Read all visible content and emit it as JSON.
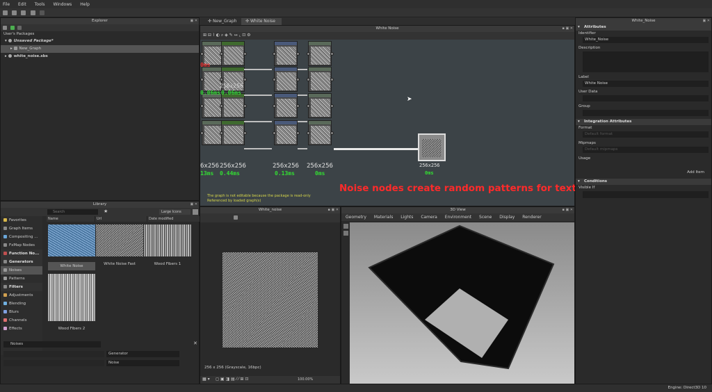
{
  "menu": [
    "File",
    "Edit",
    "Tools",
    "Windows",
    "Help"
  ],
  "explorer": {
    "title": "Explorer",
    "section": "User's Packages",
    "items": [
      {
        "label": "Unsaved Package*",
        "indent": 1
      },
      {
        "label": "New_Graph",
        "indent": 2
      },
      {
        "label": "white_noise.sbs",
        "indent": 1
      }
    ]
  },
  "tabs": [
    "New_Graph",
    "White Noise"
  ],
  "graph": {
    "title": "White Noise",
    "sizes": [
      "6x256",
      "256x256",
      "256x256",
      "256x256",
      "256x256"
    ],
    "times": [
      "13ms",
      "0.44ms",
      "0.13ms",
      "0ms",
      "0ms"
    ],
    "partial_labels": {
      "red": "0ms",
      "green1": "256x256",
      "green2": "0.06ms",
      "green3": "0.06ms"
    },
    "info_line1": "The graph is not editable because the package is read-only",
    "info_line2": "Referenced by loaded graph(s)",
    "caption": "Noise nodes create random patterns for textures"
  },
  "library": {
    "title": "Library",
    "search_placeholder": "Search",
    "view_mode": "Large Icons",
    "columns": [
      "Name",
      "Url",
      "Date modified"
    ],
    "categories": [
      {
        "label": "Favorites",
        "head": false,
        "color": "#d8b84a"
      },
      {
        "label": "Graph Items",
        "head": false,
        "color": "#888888"
      },
      {
        "label": "Compositing ...",
        "head": false,
        "color": "#6aa6d8"
      },
      {
        "label": "FxMap Nodes",
        "head": false,
        "color": "#888888"
      },
      {
        "label": "Function No...",
        "head": true,
        "color": "#c05050"
      },
      {
        "label": "Generators",
        "head": true,
        "color": "#888888"
      },
      {
        "label": "Noises",
        "head": false,
        "color": "#9a9a9a",
        "selected": true
      },
      {
        "label": "Patterns",
        "head": false,
        "color": "#9a9a9a"
      },
      {
        "label": "Filters",
        "head": true,
        "color": "#888888"
      },
      {
        "label": "Adjustments",
        "head": false,
        "color": "#d0a050"
      },
      {
        "label": "Blending",
        "head": false,
        "color": "#70b0e0"
      },
      {
        "label": "Blurs",
        "head": false,
        "color": "#80a0e0"
      },
      {
        "label": "Channels",
        "head": false,
        "color": "#e07070"
      },
      {
        "label": "Effects",
        "head": false,
        "color": "#d0a0d0"
      }
    ],
    "thumbs": [
      "White Noise",
      "White Noise Fast",
      "Wood Fibers 1",
      "Wood Fibers 2"
    ],
    "filter_label": "Noises",
    "bottom_fields": [
      "Generator",
      "Noise"
    ]
  },
  "preview2d": {
    "title": "White_noise",
    "status": "256 x 256 (Grayscale, 16bpc)",
    "zoom": "100.00%"
  },
  "view3d": {
    "title": "3D View",
    "menu": [
      "Geometry",
      "Materials",
      "Lights",
      "Camera",
      "Environment",
      "Scene",
      "Display",
      "Renderer"
    ]
  },
  "attributes": {
    "window_title": "White_Noise",
    "section": "Attributes",
    "identifier_label": "Identifier",
    "identifier_value": "White_Noise",
    "description_label": "Description",
    "label_label": "Label",
    "label_value": "White Noise",
    "user_data_label": "User Data",
    "group_label": "Group",
    "integration_section": "Integration Attributes",
    "format_label": "Format",
    "format_value": "Default format",
    "mipmaps_label": "Mipmaps",
    "mipmaps_value": "Default mipmaps",
    "usage_label": "Usage",
    "add_item": "Add Item",
    "conditions_section": "Conditions",
    "visible_if_label": "Visible If"
  },
  "statusbar": {
    "engine": "Engine: Direct3D 10"
  }
}
